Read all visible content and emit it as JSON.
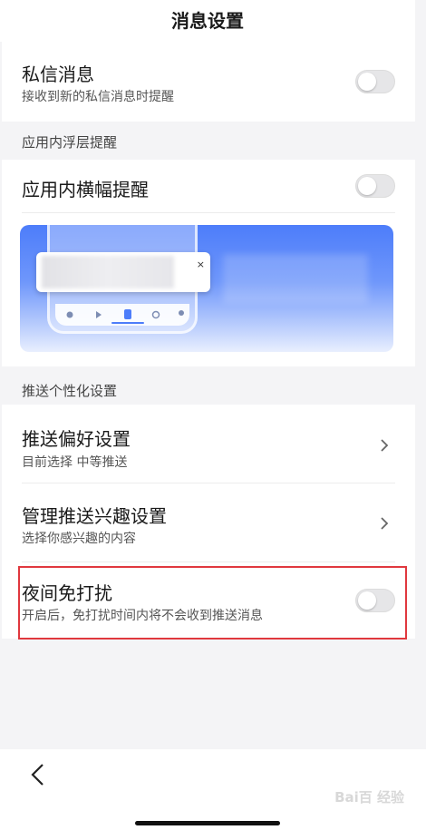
{
  "header": {
    "title": "消息设置"
  },
  "private_message": {
    "label": "私信消息",
    "desc": "接收到新的私信消息时提醒",
    "enabled": false
  },
  "in_app_section": {
    "heading": "应用内浮层提醒",
    "banner_toggle": {
      "label": "应用内横幅提醒",
      "enabled": false
    },
    "preview": {
      "close_glyph": "×"
    }
  },
  "push_section": {
    "heading": "推送个性化设置",
    "items": [
      {
        "label": "推送偏好设置",
        "desc": "目前选择 中等推送"
      },
      {
        "label": "管理推送兴趣设置",
        "desc": "选择你感兴趣的内容"
      }
    ],
    "dnd": {
      "label": "夜间免打扰",
      "desc": "开启后，免打扰时间内将不会收到推送消息",
      "enabled": false
    }
  },
  "navigation": {
    "back_icon": "chevron-left-icon"
  },
  "watermark": {
    "text": "Bai百 经验"
  },
  "colors": {
    "highlight": "#e0383e",
    "banner": "#4d7dfa"
  }
}
